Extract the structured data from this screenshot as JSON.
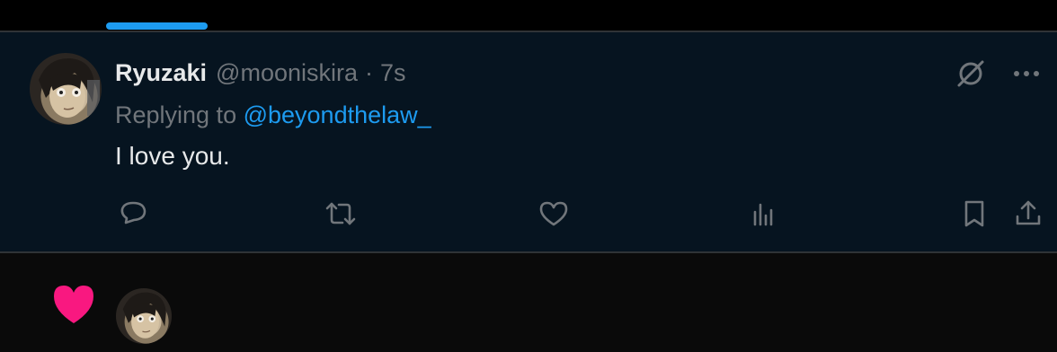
{
  "tweet": {
    "author_name": "Ryuzaki",
    "author_handle": "@mooniskira",
    "separator": "·",
    "time": "7s",
    "replying_prefix": "Replying to ",
    "replying_to": "@beyondthelaw_",
    "text": "I love you."
  },
  "icons": {
    "top": [
      "grok-icon",
      "more-icon"
    ],
    "actions": [
      "reply-icon",
      "retweet-icon",
      "like-icon",
      "views-icon",
      "bookmark-icon",
      "share-icon"
    ]
  },
  "colors": {
    "accent": "#1d9bf0",
    "like": "#f91880",
    "muted": "#71767b",
    "tweet_bg": "#061420"
  }
}
